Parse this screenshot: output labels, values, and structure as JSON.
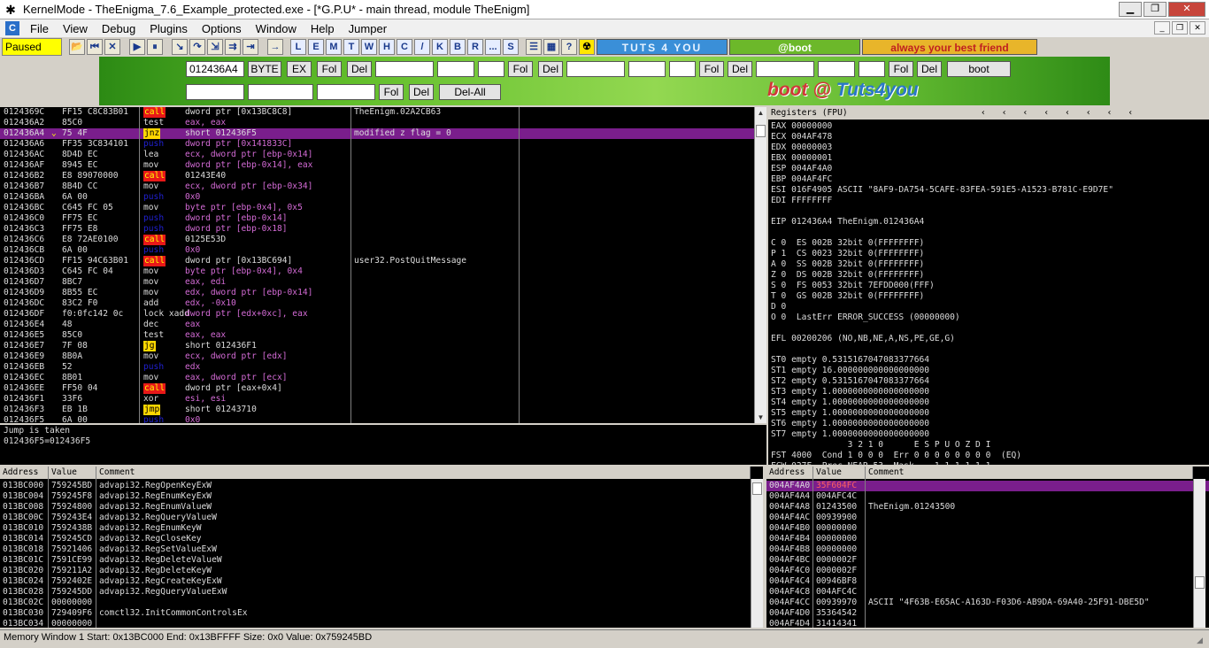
{
  "window": {
    "title": "KernelMode - TheEnigma_7.6_Example_protected.exe - [*G.P.U* - main thread, module TheEnigm]",
    "icon": "bug-icon"
  },
  "menu": [
    "File",
    "View",
    "Debug",
    "Plugins",
    "Options",
    "Window",
    "Help",
    "Jumper"
  ],
  "toolbar": {
    "status": "Paused",
    "buttons": [
      "L",
      "E",
      "M",
      "T",
      "W",
      "H",
      "C",
      "/",
      "K",
      "B",
      "R",
      "...",
      "S"
    ],
    "banners": [
      "TUTS 4 YOU",
      "@boot",
      "always your best friend"
    ]
  },
  "plugin": {
    "addr": "012436A4",
    "byte": "BYTE",
    "ex": "EX",
    "fol": "Fol",
    "del": "Del",
    "boot": "boot",
    "delall": "Del-All",
    "logo_a": "boot",
    "logo_at": " @ ",
    "logo_b": "Tuts4you"
  },
  "cpu": {
    "rows": [
      [
        "0124369C",
        "FF15 C8C83B01",
        "call",
        "dword ptr [0x13BC8C8]",
        "TheEnigm.02A2CB63",
        "call"
      ],
      [
        "012436A2",
        "85C0",
        "test",
        "eax, eax",
        "",
        ""
      ],
      [
        "012436A4",
        "75 4F",
        "jnz",
        "short 012436F5",
        "modified z flag = 0",
        "jmp"
      ],
      [
        "012436A6",
        "FF35 3C834101",
        "push",
        "dword ptr [0x141833C]",
        "",
        "push"
      ],
      [
        "012436AC",
        "8D4D EC",
        "lea",
        "ecx, dword ptr [ebp-0x14]",
        "",
        ""
      ],
      [
        "012436AF",
        "8945 EC",
        "mov",
        "dword ptr [ebp-0x14], eax",
        "",
        ""
      ],
      [
        "012436B2",
        "E8 89070000",
        "call",
        "01243E40",
        "",
        "call"
      ],
      [
        "012436B7",
        "8B4D CC",
        "mov",
        "ecx, dword ptr [ebp-0x34]",
        "",
        ""
      ],
      [
        "012436BA",
        "6A 00",
        "push",
        "0x0",
        "",
        "push"
      ],
      [
        "012436BC",
        "C645 FC 05",
        "mov",
        "byte ptr [ebp-0x4], 0x5",
        "",
        ""
      ],
      [
        "012436C0",
        "FF75 EC",
        "push",
        "dword ptr [ebp-0x14]",
        "",
        "push"
      ],
      [
        "012436C3",
        "FF75 E8",
        "push",
        "dword ptr [ebp-0x18]",
        "",
        "push"
      ],
      [
        "012436C6",
        "E8 72AE0100",
        "call",
        "0125E53D",
        "",
        "call"
      ],
      [
        "012436CB",
        "6A 00",
        "push",
        "0x0",
        "",
        "push"
      ],
      [
        "012436CD",
        "FF15 94C63B01",
        "call",
        "dword ptr [0x13BC694]",
        "user32.PostQuitMessage",
        "call"
      ],
      [
        "012436D3",
        "C645 FC 04",
        "mov",
        "byte ptr [ebp-0x4], 0x4",
        "",
        ""
      ],
      [
        "012436D7",
        "8BC7",
        "mov",
        "eax, edi",
        "",
        ""
      ],
      [
        "012436D9",
        "8B55 EC",
        "mov",
        "edx, dword ptr [ebp-0x14]",
        "",
        ""
      ],
      [
        "012436DC",
        "83C2 F0",
        "add",
        "edx, -0x10",
        "",
        ""
      ],
      [
        "012436DF",
        "f0:0fc142 0c",
        "lock xadd",
        "dword ptr [edx+0xc], eax",
        "",
        ""
      ],
      [
        "012436E4",
        "48",
        "dec",
        "eax",
        "",
        ""
      ],
      [
        "012436E5",
        "85C0",
        "test",
        "eax, eax",
        "",
        ""
      ],
      [
        "012436E7",
        "7F 08",
        "jg",
        "short 012436F1",
        "",
        "jmp"
      ],
      [
        "012436E9",
        "8B0A",
        "mov",
        "ecx, dword ptr [edx]",
        "",
        ""
      ],
      [
        "012436EB",
        "52",
        "push",
        "edx",
        "",
        "push"
      ],
      [
        "012436EC",
        "8B01",
        "mov",
        "eax, dword ptr [ecx]",
        "",
        ""
      ],
      [
        "012436EE",
        "FF50 04",
        "call",
        "dword ptr [eax+0x4]",
        "",
        "call"
      ],
      [
        "012436F1",
        "33F6",
        "xor",
        "esi, esi",
        "",
        ""
      ],
      [
        "012436F3",
        "EB 1B",
        "jmp",
        "short 01243710",
        "",
        "jmp"
      ],
      [
        "012436F5",
        "6A 00",
        "push",
        "0x0",
        "",
        "push"
      ]
    ],
    "selected_index": 2
  },
  "info": [
    "Jump is taken",
    "012436F5=012436F5"
  ],
  "registers": {
    "title": "Registers (FPU)",
    "lines": [
      "EAX 00000000",
      "ECX 004AF478",
      "EDX 00000003",
      "EBX 00000001",
      "ESP 004AF4A0",
      "EBP 004AF4FC",
      "ESI 016F4905 ASCII \"8AF9-DA754-5CAFE-83FEA-591E5-A1523-B781C-E9D7E\"",
      "EDI FFFFFFFF",
      "",
      "EIP 012436A4 TheEnigm.012436A4",
      "",
      "C 0  ES 002B 32bit 0(FFFFFFFF)",
      "P 1  CS 0023 32bit 0(FFFFFFFF)",
      "A 0  SS 002B 32bit 0(FFFFFFFF)",
      "Z 0  DS 002B 32bit 0(FFFFFFFF)",
      "S 0  FS 0053 32bit 7EFDD000(FFF)",
      "T 0  GS 002B 32bit 0(FFFFFFFF)",
      "D 0",
      "O 0  LastErr ERROR_SUCCESS (00000000)",
      "",
      "EFL 00200206 (NO,NB,NE,A,NS,PE,GE,G)",
      "",
      "ST0 empty 0.5315167047083377664",
      "ST1 empty 16.000000000000000000",
      "ST2 empty 0.5315167047083377664",
      "ST3 empty 1.0000000000000000000",
      "ST4 empty 1.0000000000000000000",
      "ST5 empty 1.0000000000000000000",
      "ST6 empty 1.0000000000000000000",
      "ST7 empty 1.0000000000000000000",
      "               3 2 1 0      E S P U O Z D I",
      "FST 4000  Cond 1 0 0 0  Err 0 0 0 0 0 0 0 0  (EQ)",
      "FCW 027F  Prec NEAR,53  Mask    1 1 1 1 1 1"
    ]
  },
  "dump": {
    "headers": [
      "Address",
      "Value",
      "Comment"
    ],
    "rows": [
      [
        "013BC000",
        "759245BD",
        "advapi32.RegOpenKeyExW"
      ],
      [
        "013BC004",
        "759245F8",
        "advapi32.RegEnumKeyExW"
      ],
      [
        "013BC008",
        "75924800",
        "advapi32.RegEnumValueW"
      ],
      [
        "013BC00C",
        "759243E4",
        "advapi32.RegQueryValueW"
      ],
      [
        "013BC010",
        "7592438B",
        "advapi32.RegEnumKeyW"
      ],
      [
        "013BC014",
        "759245CD",
        "advapi32.RegCloseKey"
      ],
      [
        "013BC018",
        "75921406",
        "advapi32.RegSetValueExW"
      ],
      [
        "013BC01C",
        "7591CE99",
        "advapi32.RegDeleteValueW"
      ],
      [
        "013BC020",
        "759211A2",
        "advapi32.RegDeleteKeyW"
      ],
      [
        "013BC024",
        "7592402E",
        "advapi32.RegCreateKeyExW"
      ],
      [
        "013BC028",
        "759245DD",
        "advapi32.RegQueryValueExW"
      ],
      [
        "013BC02C",
        "00000000",
        ""
      ],
      [
        "013BC030",
        "729409F6",
        "comctl32.InitCommonControlsEx"
      ],
      [
        "013BC034",
        "00000000",
        ""
      ]
    ]
  },
  "stack": {
    "headers": [
      "Address",
      "Value",
      "Comment"
    ],
    "rows": [
      [
        "004AF4A0",
        "35F604FC",
        ""
      ],
      [
        "004AF4A4",
        "004AFC4C",
        ""
      ],
      [
        "004AF4A8",
        "01243500",
        "TheEnigm.01243500"
      ],
      [
        "004AF4AC",
        "00939900",
        ""
      ],
      [
        "004AF4B0",
        "00000000",
        ""
      ],
      [
        "004AF4B4",
        "00000000",
        ""
      ],
      [
        "004AF4B8",
        "00000000",
        ""
      ],
      [
        "004AF4BC",
        "0000002F",
        ""
      ],
      [
        "004AF4C0",
        "0000002F",
        ""
      ],
      [
        "004AF4C4",
        "00946BF8",
        ""
      ],
      [
        "004AF4C8",
        "004AFC4C",
        ""
      ],
      [
        "004AF4CC",
        "00939970",
        "ASCII \"4F63B-E65AC-A163D-F03D6-AB9DA-69A40-25F91-DBE5D\""
      ],
      [
        "004AF4D0",
        "35364542",
        ""
      ],
      [
        "004AF4D4",
        "31414341",
        ""
      ]
    ],
    "selected_index": 0
  },
  "status": "Memory Window 1  Start: 0x13BC000  End: 0x13BFFFF  Size: 0x0 Value: 0x759245BD",
  "colors": {
    "call_bg": "#e81818",
    "jmp_bg": "#ffd700",
    "selected_row": "#7a1e8c",
    "paused_bg": "#ffff00"
  }
}
